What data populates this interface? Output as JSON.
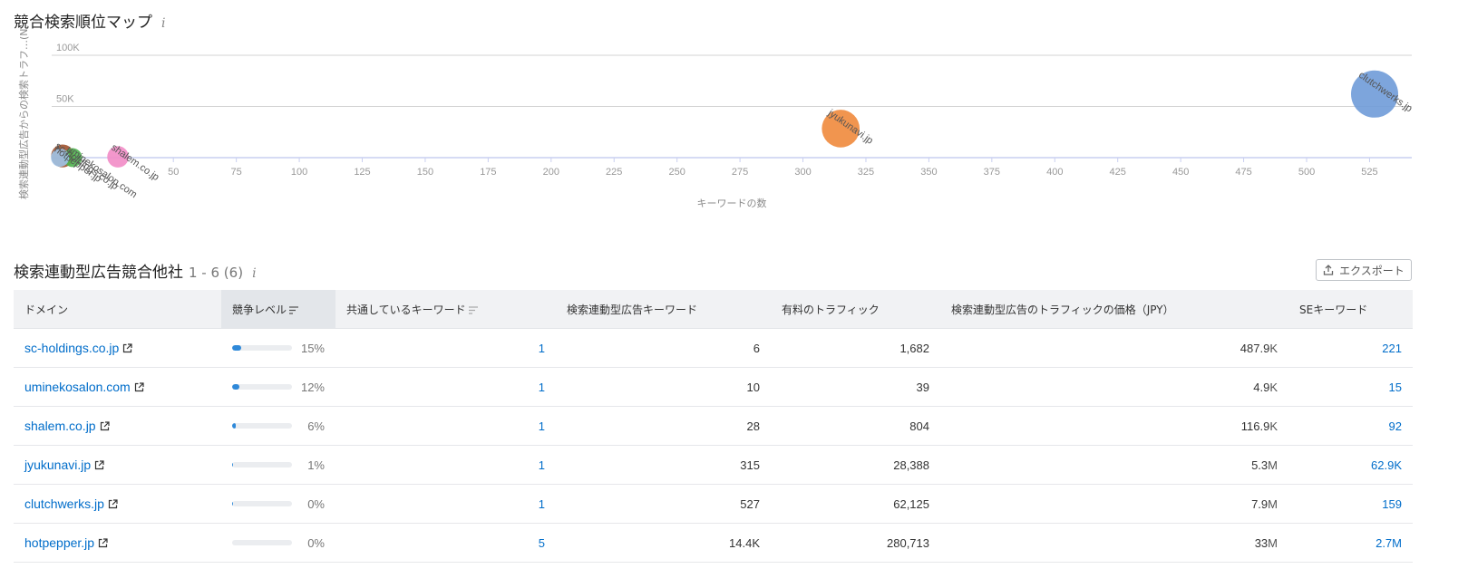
{
  "chart_section": {
    "title": "競合検索順位マップ",
    "info_icon": "info-icon"
  },
  "chart_data": {
    "type": "scatter",
    "xlabel": "キーワードの数",
    "ylabel": "検索連動型広告からの検索トラフ…(N)",
    "xlim": [
      0,
      540
    ],
    "ylim": [
      0,
      100000
    ],
    "x_ticks": [
      "50",
      "75",
      "100",
      "125",
      "150",
      "175",
      "200",
      "225",
      "250",
      "275",
      "300",
      "325",
      "350",
      "375",
      "400",
      "425",
      "450",
      "475",
      "500",
      "525"
    ],
    "x_tick_values": [
      50,
      75,
      100,
      125,
      150,
      175,
      200,
      225,
      250,
      275,
      300,
      325,
      350,
      375,
      400,
      425,
      450,
      475,
      500,
      525
    ],
    "y_ticks": [
      "100K",
      "50K"
    ],
    "y_tick_values": [
      100000,
      50000
    ],
    "grid": true,
    "legend": "none",
    "points": [
      {
        "label": "sc-holdings.co.jp",
        "x": 6,
        "y": 1682,
        "color": "#a0522d"
      },
      {
        "label": "uminekosalon.com",
        "x": 10,
        "y": 39,
        "color": "#4fb34f"
      },
      {
        "label": "shalem.co.jp",
        "x": 28,
        "y": 804,
        "color": "#f28cc6"
      },
      {
        "label": "jyukunavi.jp",
        "x": 315,
        "y": 28388,
        "color": "#f08a3c"
      },
      {
        "label": "clutchwerks.jp",
        "x": 527,
        "y": 62125,
        "color": "#6f9bd8"
      },
      {
        "label": "hotpepper.jp",
        "x": 5,
        "y": 0,
        "color": "#9fc3e8"
      }
    ]
  },
  "table_section": {
    "title": "検索連動型広告競合他社",
    "count": "1 - 6 (6)",
    "info_icon": "info-icon",
    "export_label": "エクスポート"
  },
  "table": {
    "columns": [
      "ドメイン",
      "競争レベル",
      "共通しているキーワード",
      "検索連動型広告キーワード",
      "有料のトラフィック",
      "検索連動型広告のトラフィックの価格（JPY）",
      "SEキーワード"
    ],
    "rows": [
      {
        "domain": "sc-holdings.co.jp",
        "level": 0.15,
        "level_text": "15%",
        "common": "1",
        "ads_kw": "6",
        "traffic": "1,682",
        "price": "487.9",
        "price_unit": "K",
        "se_kw": "221"
      },
      {
        "domain": "uminekosalon.com",
        "level": 0.12,
        "level_text": "12%",
        "common": "1",
        "ads_kw": "10",
        "traffic": "39",
        "price": "4.9",
        "price_unit": "K",
        "se_kw": "15"
      },
      {
        "domain": "shalem.co.jp",
        "level": 0.06,
        "level_text": "6%",
        "common": "1",
        "ads_kw": "28",
        "traffic": "804",
        "price": "116.9",
        "price_unit": "K",
        "se_kw": "92"
      },
      {
        "domain": "jyukunavi.jp",
        "level": 0.01,
        "level_text": "1%",
        "common": "1",
        "ads_kw": "315",
        "traffic": "28,388",
        "price": "5.3",
        "price_unit": "M",
        "se_kw": "62.9K"
      },
      {
        "domain": "clutchwerks.jp",
        "level": 0.005,
        "level_text": "0%",
        "common": "1",
        "ads_kw": "527",
        "traffic": "62,125",
        "price": "7.9",
        "price_unit": "M",
        "se_kw": "159"
      },
      {
        "domain": "hotpepper.jp",
        "level": 0,
        "level_text": "0%",
        "common": "5",
        "ads_kw": "14.4K",
        "traffic": "280,713",
        "price": "33",
        "price_unit": "M",
        "se_kw": "2.7M"
      }
    ]
  }
}
